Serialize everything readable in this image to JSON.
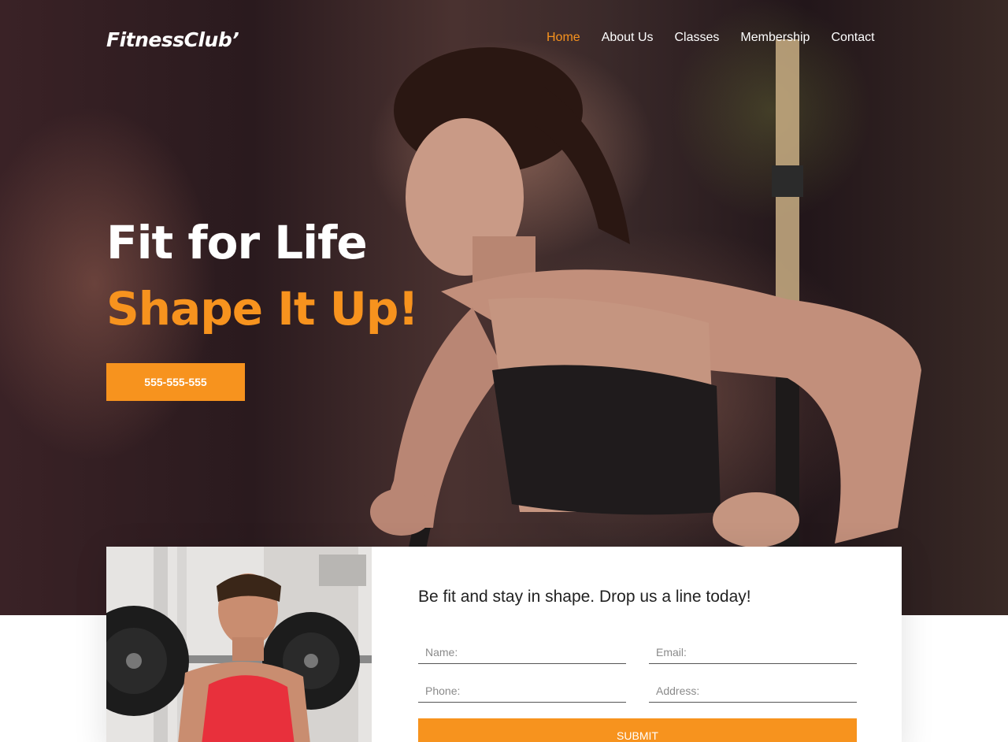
{
  "header": {
    "logo": "FitnessClub’",
    "nav": [
      "Home",
      "About Us",
      "Classes",
      "Membership",
      "Contact"
    ],
    "active_nav": "Home"
  },
  "hero": {
    "title_line1": "Fit for Life",
    "title_line2": "Shape It Up!",
    "phone_button": "555-555-555"
  },
  "contact_form": {
    "heading": "Be fit and stay in shape. Drop us a line today!",
    "name_placeholder": "Name:",
    "email_placeholder": "Email:",
    "phone_placeholder": "Phone:",
    "address_placeholder": "Address:",
    "submit_label": "SUBMIT"
  },
  "colors": {
    "accent": "#f7931e",
    "hero_dark": "#2a1a1e",
    "white": "#ffffff"
  }
}
